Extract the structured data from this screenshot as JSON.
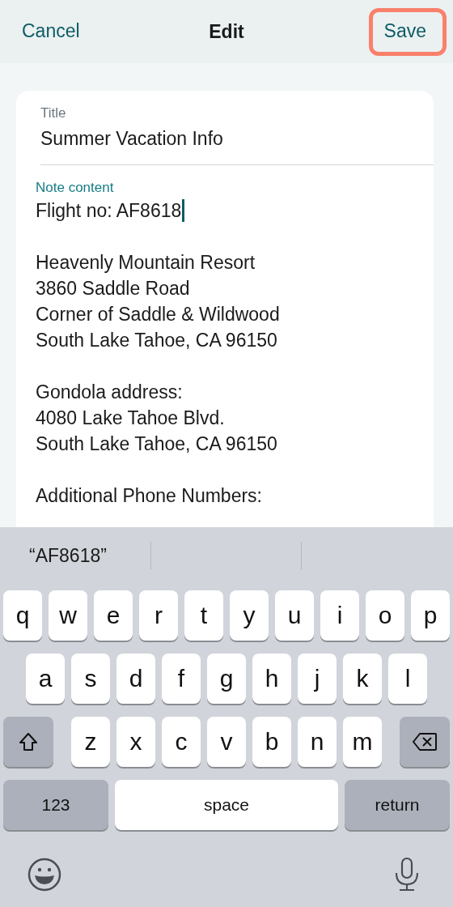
{
  "nav": {
    "cancel": "Cancel",
    "title": "Edit",
    "save": {
      "label": "Save",
      "highlighted": true
    }
  },
  "title_field": {
    "label": "Title",
    "value": "Summer Vacation Info"
  },
  "note_field": {
    "label": "Note content",
    "focused": true,
    "paragraphs": [
      [
        {
          "text": "Flight no: AF8618",
          "caret": true
        }
      ],
      [
        {
          "text": "Heavenly Mountain Resort",
          "caret": false
        },
        {
          "text": "3860 Saddle Road",
          "caret": false
        },
        {
          "text": "Corner of Saddle & Wildwood",
          "caret": false
        },
        {
          "text": "South Lake Tahoe, CA 96150",
          "caret": false
        }
      ],
      [
        {
          "text": "Gondola address:",
          "caret": false
        },
        {
          "text": "4080 Lake Tahoe Blvd.",
          "caret": false
        },
        {
          "text": "South Lake Tahoe, CA 96150",
          "caret": false
        }
      ],
      [
        {
          "text": "Additional Phone Numbers:",
          "caret": false
        }
      ]
    ]
  },
  "keyboard": {
    "suggestions": [
      "“AF8618”"
    ],
    "rows": [
      [
        {
          "kind": "letter",
          "label": "q"
        },
        {
          "kind": "letter",
          "label": "w"
        },
        {
          "kind": "letter",
          "label": "e"
        },
        {
          "kind": "letter",
          "label": "r"
        },
        {
          "kind": "letter",
          "label": "t"
        },
        {
          "kind": "letter",
          "label": "y"
        },
        {
          "kind": "letter",
          "label": "u"
        },
        {
          "kind": "letter",
          "label": "i"
        },
        {
          "kind": "letter",
          "label": "o"
        },
        {
          "kind": "letter",
          "label": "p"
        }
      ],
      [
        {
          "kind": "letter",
          "label": "a"
        },
        {
          "kind": "letter",
          "label": "s"
        },
        {
          "kind": "letter",
          "label": "d"
        },
        {
          "kind": "letter",
          "label": "f"
        },
        {
          "kind": "letter",
          "label": "g"
        },
        {
          "kind": "letter",
          "label": "h"
        },
        {
          "kind": "letter",
          "label": "j"
        },
        {
          "kind": "letter",
          "label": "k"
        },
        {
          "kind": "letter",
          "label": "l"
        }
      ],
      [
        {
          "kind": "shift"
        },
        {
          "kind": "letter",
          "label": "z"
        },
        {
          "kind": "letter",
          "label": "x"
        },
        {
          "kind": "letter",
          "label": "c"
        },
        {
          "kind": "letter",
          "label": "v"
        },
        {
          "kind": "letter",
          "label": "b"
        },
        {
          "kind": "letter",
          "label": "n"
        },
        {
          "kind": "letter",
          "label": "m"
        },
        {
          "kind": "delete"
        }
      ]
    ],
    "bottom_keys": {
      "numbers": "123",
      "space": "space",
      "return": "return"
    }
  }
}
